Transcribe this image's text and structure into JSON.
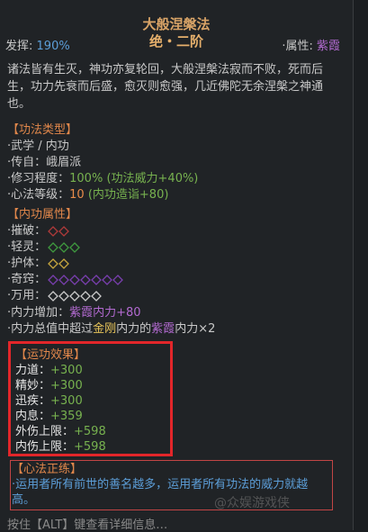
{
  "title": "大般涅槃法",
  "rank": "绝・二阶",
  "header": {
    "effect_label": "发挥:",
    "effect_value": "190%",
    "attr_label": "·属性:",
    "attr_value": "紫霞"
  },
  "description": "诸法皆有生灭，神功亦复轮回，大般涅槃法寂而不败，死而后生，功力先衰而后盛，愈灭则愈强，几近佛陀无余涅槃之神通也。",
  "type_section": {
    "title": "【功法类型】",
    "rows": [
      {
        "label": "·武学 / 内功",
        "value": ""
      },
      {
        "label": "·传自：",
        "value": "峨眉派"
      },
      {
        "label": "·修习程度：",
        "value": "100%",
        "extra": "(功法威力+40%)"
      },
      {
        "label": "·心法等级：",
        "value": "10",
        "extra": "(内功造诣+80)"
      }
    ]
  },
  "attr_section": {
    "title": "【内功属性】",
    "rows": [
      {
        "label": "·摧破：",
        "diamonds": [
          "#b03a3a",
          "#b03a3a"
        ]
      },
      {
        "label": "·轻灵：",
        "diamonds": [
          "#3f9a3f",
          "#3f9a3f",
          "#3f9a3f"
        ]
      },
      {
        "label": "·护体：",
        "diamonds": [
          "#c7a63e",
          "#c7a63e"
        ]
      },
      {
        "label": "·奇窍：",
        "diamonds": [
          "#7a3fb0",
          "#7a3fb0",
          "#7a3fb0",
          "#7a3fb0",
          "#7a3fb0",
          "#7a3fb0",
          "#7a3fb0"
        ]
      },
      {
        "label": "·万用：",
        "diamonds": [
          "#cccccc",
          "#cccccc",
          "#cccccc",
          "#cccccc",
          "#cccccc"
        ]
      }
    ]
  },
  "neili": {
    "line1_label": "·内力增加：",
    "line1_value": "紫霞内力+80",
    "line2_a": "·内力总值中超过",
    "line2_b": "金刚",
    "line2_c": "内力的",
    "line2_d": "紫霞",
    "line2_e": "内力×2"
  },
  "effects": {
    "title": "【运功效果】",
    "rows": [
      {
        "label": "力道：",
        "value": "+300"
      },
      {
        "label": "精妙：",
        "value": "+300"
      },
      {
        "label": "迅疾：",
        "value": "+300"
      },
      {
        "label": "内息：",
        "value": "+359"
      },
      {
        "label": "外伤上限：",
        "value": "+598"
      },
      {
        "label": "内伤上限：",
        "value": "+598"
      }
    ]
  },
  "heart": {
    "title": "【心法正练】",
    "text": "·运用者所有前世的善名越多，运用者所有功法的威力就越高。"
  },
  "footer": "按住【ALT】键查看详细信息…",
  "watermark": "@众娱游戏侠"
}
